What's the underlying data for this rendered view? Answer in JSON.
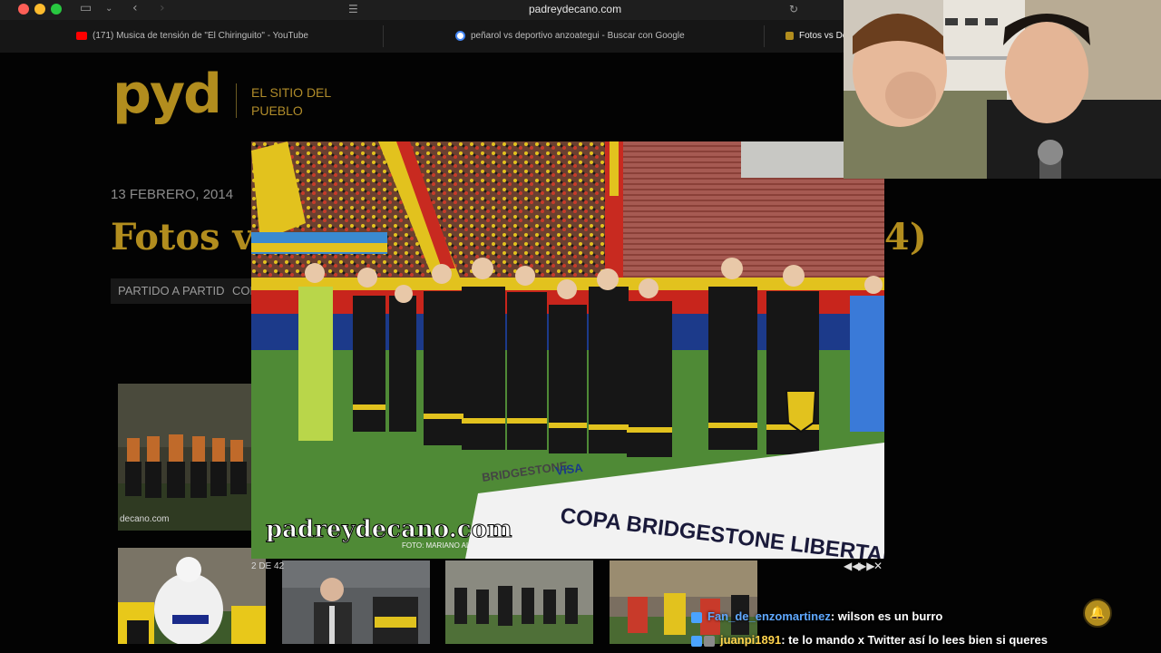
{
  "browser": {
    "url": "padreydecano.com",
    "tabs": [
      {
        "label": "(171) Musica de tensión de \"El Chiringuito\" - YouTube",
        "favicon": "youtube-icon",
        "color": "#ff0000"
      },
      {
        "label": "peñarol vs deportivo anzoategui - Buscar con Google",
        "favicon": "google-icon",
        "color": "#4285f4"
      },
      {
        "label": "Fotos vs De",
        "favicon": "pyd-icon",
        "color": "#b28d1e"
      }
    ]
  },
  "site": {
    "logo": "pyd",
    "tagline": "EL SITIO DEL PUEBLO",
    "accent": "#b28d1e"
  },
  "post": {
    "date": "13 FEBRERO, 2014",
    "title_start": "Fotos vs",
    "title_end": "4)",
    "categories": [
      "PARTIDO A PARTIDO",
      "COP"
    ]
  },
  "gallery": {
    "thumb_watermark": "decano.com"
  },
  "lightbox": {
    "watermark": "padreydecano.com",
    "photo_credit": "FOTO: MARIANO ALVEZ",
    "banner_brand": "BRIDGESTONE",
    "banner_visa": "VISA",
    "banner_copa": "COPA BRIDGESTONE LIBERTADORES",
    "counter": "2 DE 42",
    "prev_icon": "rewind-icon",
    "next_icon": "fast-forward-icon",
    "close_icon": "close-icon"
  },
  "chat": [
    {
      "user": "Fan_de_enzomartinez",
      "message": ": wilson es un burro"
    },
    {
      "user": "juanpi1891",
      "message": ": te lo mando x Twitter así lo lees bien si queres"
    }
  ]
}
